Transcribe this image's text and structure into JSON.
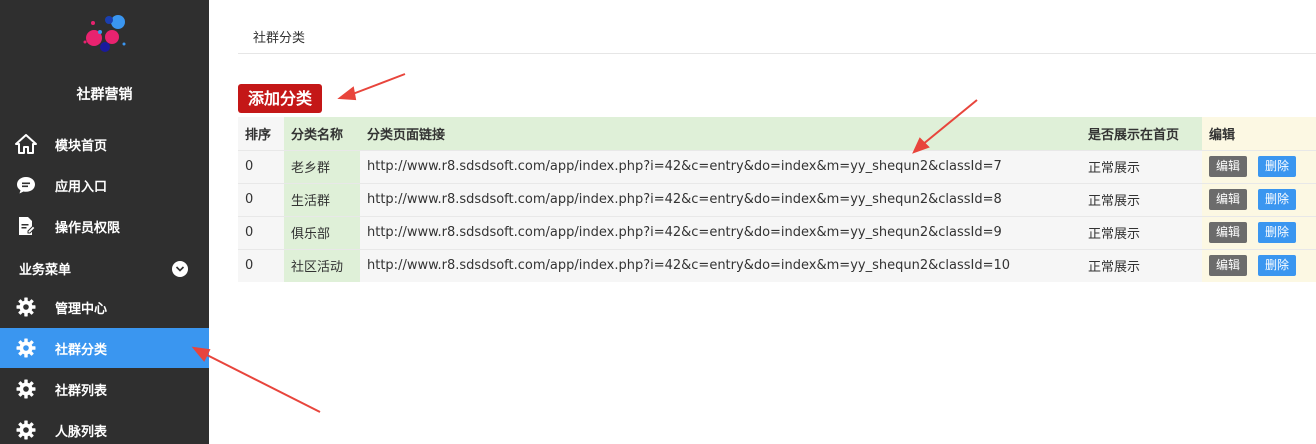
{
  "sidebar": {
    "brand": "社群营销",
    "items": [
      {
        "label": "模块首页",
        "icon": "home-icon"
      },
      {
        "label": "应用入口",
        "icon": "chat-icon"
      },
      {
        "label": "操作员权限",
        "icon": "document-edit-icon"
      }
    ],
    "group_title": "业务菜单",
    "group_items": [
      {
        "label": "管理中心",
        "icon": "gear-icon"
      },
      {
        "label": "社群分类",
        "icon": "gear-icon"
      },
      {
        "label": "社群列表",
        "icon": "gear-icon"
      },
      {
        "label": "人脉列表",
        "icon": "gear-icon"
      }
    ],
    "active_color": "#3a96f0"
  },
  "breadcrumb": "社群分类",
  "add_button": "添加分类",
  "table": {
    "headers": [
      "排序",
      "分类名称",
      "分类页面链接",
      "是否展示在首页",
      "编辑"
    ],
    "rows": [
      {
        "sort": "0",
        "name": "老乡群",
        "link": "http://www.r8.sdsdsoft.com/app/index.php?i=42&c=entry&do=index&m=yy_shequn2&classId=7",
        "show": "正常展示",
        "edit": "编辑",
        "del": "删除"
      },
      {
        "sort": "0",
        "name": "生活群",
        "link": "http://www.r8.sdsdsoft.com/app/index.php?i=42&c=entry&do=index&m=yy_shequn2&classId=8",
        "show": "正常展示",
        "edit": "编辑",
        "del": "删除"
      },
      {
        "sort": "0",
        "name": "俱乐部",
        "link": "http://www.r8.sdsdsoft.com/app/index.php?i=42&c=entry&do=index&m=yy_shequn2&classId=9",
        "show": "正常展示",
        "edit": "编辑",
        "del": "删除"
      },
      {
        "sort": "0",
        "name": "社区活动",
        "link": "http://www.r8.sdsdsoft.com/app/index.php?i=42&c=entry&do=index&m=yy_shequn2&classId=10",
        "show": "正常展示",
        "edit": "编辑",
        "del": "删除"
      }
    ]
  },
  "colors": {
    "add_button": "#c41717",
    "edit_button": "#6c6c6c",
    "delete_button": "#3a96f0",
    "annotation_arrow": "#e8453c"
  }
}
